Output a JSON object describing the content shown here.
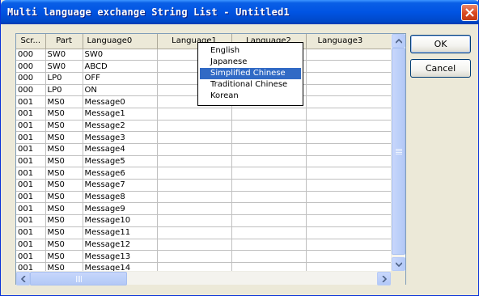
{
  "window": {
    "title": "Multi language exchange String List - Untitled1"
  },
  "grid": {
    "headers": [
      "Scr...",
      "Part",
      "Language0",
      "Language1",
      "Language2",
      "Language3"
    ],
    "rows": [
      [
        "000",
        "SW0",
        "SW0",
        "",
        "",
        ""
      ],
      [
        "000",
        "SW0",
        "ABCD",
        "",
        "",
        ""
      ],
      [
        "000",
        "LP0",
        "OFF",
        "",
        "",
        ""
      ],
      [
        "000",
        "LP0",
        "ON",
        "",
        "",
        ""
      ],
      [
        "001",
        "MS0",
        "Message0",
        "",
        "",
        ""
      ],
      [
        "001",
        "MS0",
        "Message1",
        "",
        "",
        ""
      ],
      [
        "001",
        "MS0",
        "Message2",
        "",
        "",
        ""
      ],
      [
        "001",
        "MS0",
        "Message3",
        "",
        "",
        ""
      ],
      [
        "001",
        "MS0",
        "Message4",
        "",
        "",
        ""
      ],
      [
        "001",
        "MS0",
        "Message5",
        "",
        "",
        ""
      ],
      [
        "001",
        "MS0",
        "Message6",
        "",
        "",
        ""
      ],
      [
        "001",
        "MS0",
        "Message7",
        "",
        "",
        ""
      ],
      [
        "001",
        "MS0",
        "Message8",
        "",
        "",
        ""
      ],
      [
        "001",
        "MS0",
        "Message9",
        "",
        "",
        ""
      ],
      [
        "001",
        "MS0",
        "Message10",
        "",
        "",
        ""
      ],
      [
        "001",
        "MS0",
        "Message11",
        "",
        "",
        ""
      ],
      [
        "001",
        "MS0",
        "Message12",
        "",
        "",
        ""
      ],
      [
        "001",
        "MS0",
        "Message13",
        "",
        "",
        ""
      ],
      [
        "001",
        "MS0",
        "Message14",
        "",
        "",
        ""
      ]
    ]
  },
  "dropdown": {
    "options": [
      "English",
      "Japanese",
      "Simplified Chinese",
      "Traditional Chinese",
      "Korean"
    ],
    "selected": "Simplified Chinese"
  },
  "buttons": {
    "ok": "OK",
    "cancel": "Cancel"
  },
  "colors": {
    "titlebar": "#0054e3",
    "selection": "#316ac5",
    "dialog_bg": "#ece9d8"
  },
  "icons": {
    "close": "close-icon",
    "scroll_up": "arrow-up-icon",
    "scroll_down": "arrow-down-icon",
    "scroll_left": "arrow-left-icon",
    "scroll_right": "arrow-right-icon"
  }
}
